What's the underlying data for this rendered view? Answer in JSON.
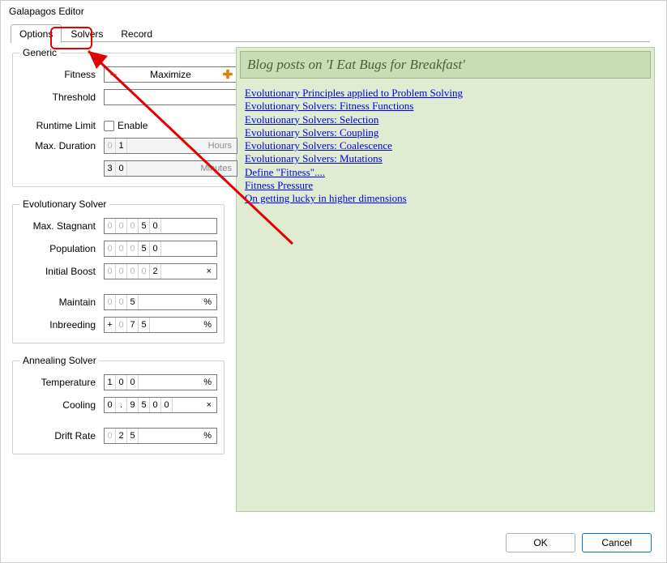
{
  "window": {
    "title": "Galapagos Editor"
  },
  "tabs": {
    "options": "Options",
    "solvers": "Solvers",
    "record": "Record",
    "active": "Options"
  },
  "generic": {
    "legend": "Generic",
    "fitness_label": "Fitness",
    "fitness_value": "Maximize",
    "threshold_label": "Threshold",
    "threshold_value": "",
    "runtime_label": "Runtime Limit",
    "runtime_enable": "Enable",
    "maxdur_label": "Max. Duration",
    "hours_digits": [
      "0",
      "1"
    ],
    "hours_unit": "Hours",
    "minutes_digits": [
      "3",
      "0"
    ],
    "minutes_unit": "Minutes"
  },
  "evo": {
    "legend": "Evolutionary Solver",
    "maxstag_label": "Max. Stagnant",
    "maxstag_digits": [
      "0",
      "0",
      "0",
      "5",
      "0"
    ],
    "pop_label": "Population",
    "pop_digits": [
      "0",
      "0",
      "0",
      "5",
      "0"
    ],
    "boost_label": "Initial Boost",
    "boost_digits": [
      "0",
      "0",
      "0",
      "0",
      "2"
    ],
    "boost_unit": "×",
    "maintain_label": "Maintain",
    "maintain_digits": [
      "0",
      "0",
      "5"
    ],
    "maintain_unit": "%",
    "inbreed_label": "Inbreeding",
    "inbreed_sign": "+",
    "inbreed_digits": [
      "0",
      "7",
      "5"
    ],
    "inbreed_unit": "%"
  },
  "anneal": {
    "legend": "Annealing Solver",
    "temp_label": "Temperature",
    "temp_digits": [
      "1",
      "0",
      "0"
    ],
    "temp_unit": "%",
    "cool_label": "Cooling",
    "cool_digits": [
      "0",
      ".",
      "9",
      "5",
      "0",
      "0"
    ],
    "cool_unit": "×",
    "drift_label": "Drift Rate",
    "drift_digits": [
      "0",
      "2",
      "5"
    ],
    "drift_unit": "%"
  },
  "blog": {
    "header": "Blog posts on 'I Eat Bugs for Breakfast'",
    "links": [
      "Evolutionary Principles applied to Problem Solving",
      "Evolutionary Solvers: Fitness Functions",
      "Evolutionary Solvers: Selection",
      "Evolutionary Solvers: Coupling",
      "Evolutionary Solvers: Coalescence",
      "Evolutionary Solvers: Mutations",
      "Define \"Fitness\"....",
      "Fitness Pressure",
      "On getting lucky in higher dimensions"
    ]
  },
  "buttons": {
    "ok": "OK",
    "cancel": "Cancel"
  }
}
